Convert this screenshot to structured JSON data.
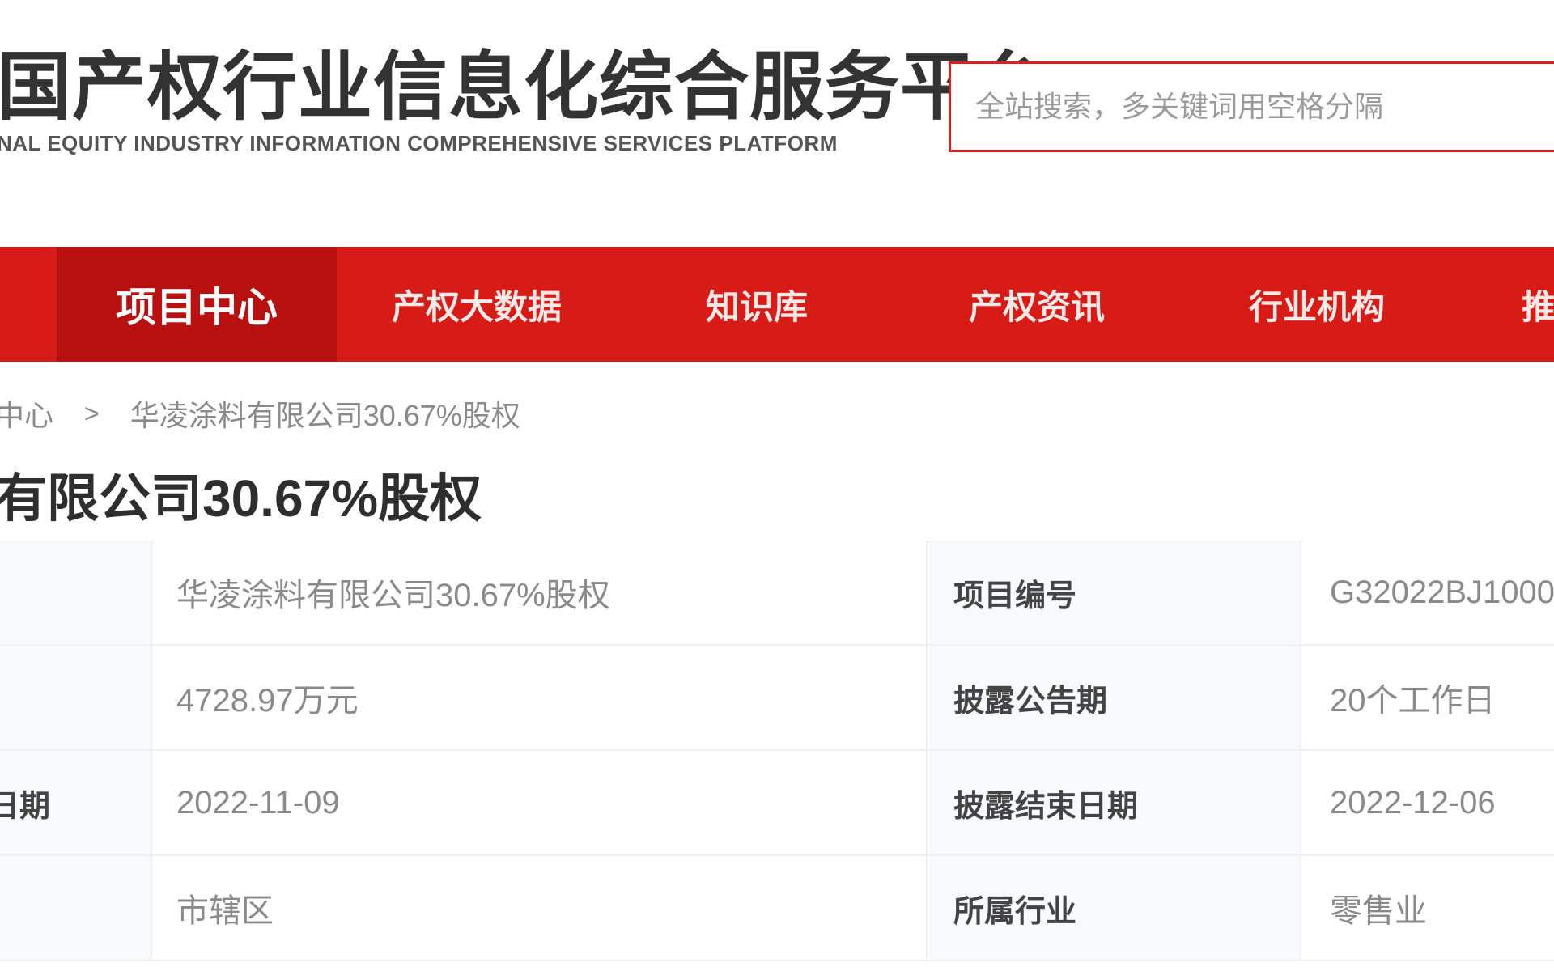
{
  "header": {
    "title_cn": "国产权行业信息化综合服务平台",
    "title_en": "NAL EQUITY INDUSTRY INFORMATION COMPREHENSIVE SERVICES PLATFORM",
    "search_placeholder": "全站搜索，多关键词用空格分隔"
  },
  "colors": {
    "brand_red": "#d71b17",
    "nav_active": "#b8110f",
    "search_border": "#e31d1a"
  },
  "nav": {
    "items": [
      {
        "label": "项目中心",
        "active": true
      },
      {
        "label": "产权大数据",
        "active": false
      },
      {
        "label": "知识库",
        "active": false
      },
      {
        "label": "产权资讯",
        "active": false
      },
      {
        "label": "行业机构",
        "active": false
      },
      {
        "label": "推",
        "active": false
      }
    ]
  },
  "breadcrumb": {
    "parent": "中心",
    "separator": ">",
    "current": "华凌涂料有限公司30.67%股权"
  },
  "page": {
    "title": "有限公司30.67%股权"
  },
  "table": {
    "rows": [
      {
        "label1": "",
        "value1": "华凌涂料有限公司30.67%股权",
        "label2": "项目编号",
        "value2": "G32022BJ1000"
      },
      {
        "label1": "",
        "value1": "4728.97万元",
        "label2": "披露公告期",
        "value2": "20个工作日"
      },
      {
        "label1": "日期",
        "value1": "2022-11-09",
        "label2": "披露结束日期",
        "value2": "2022-12-06"
      },
      {
        "label1": "",
        "value1": "市辖区",
        "label2": "所属行业",
        "value2": "零售业"
      }
    ]
  }
}
